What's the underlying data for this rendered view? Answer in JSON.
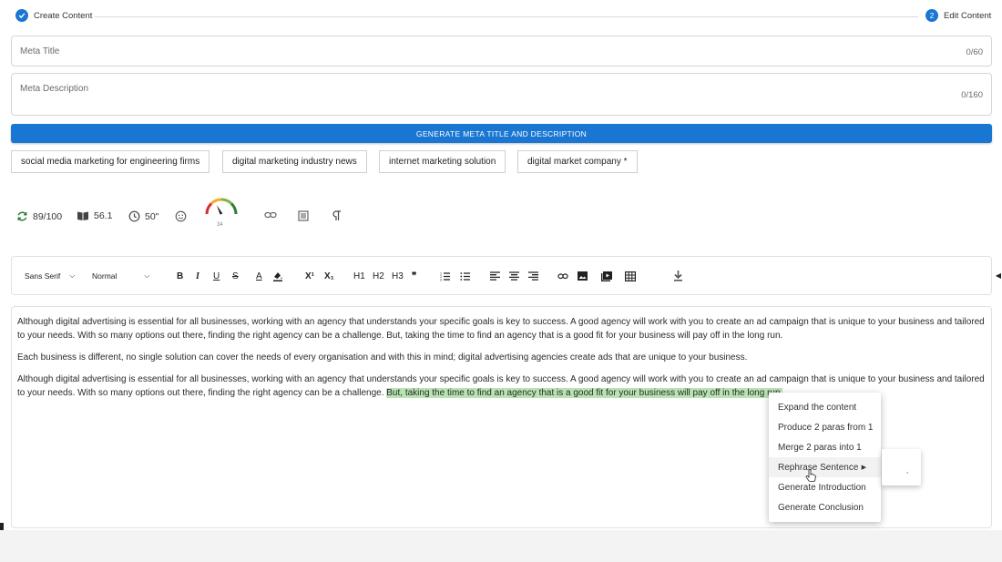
{
  "stepper": {
    "step1_label": "Create Content",
    "step2_number": "2",
    "step2_label": "Edit Content"
  },
  "meta_title": {
    "label": "Meta Title",
    "count": "0/60"
  },
  "meta_description": {
    "label": "Meta Description",
    "count": "0/160"
  },
  "generate_button": "GENERATE META TITLE AND DESCRIPTION",
  "keyword_chips": [
    "social media marketing for engineering firms",
    "digital marketing industry news",
    "internet marketing solution",
    "digital market company *"
  ],
  "metrics": {
    "score": "89/100",
    "readability": "56.1",
    "read_time": "50\"",
    "gauge_value": "34",
    "gauge_level": 0.34
  },
  "toolbar": {
    "font": "Sans Serif",
    "size": "Normal",
    "bold": "B",
    "italic": "I",
    "underline": "U",
    "strike": "S",
    "text_color": "A",
    "superscript": "X¹",
    "subscript": "X₁",
    "h1": "H1",
    "h2": "H2",
    "h3": "H3",
    "quote": "❞"
  },
  "editor": {
    "p1": "Although digital advertising is essential for all businesses, working with an agency that understands your specific goals is key to success. A good agency will work with you to create an ad campaign that is unique to your business and tailored to your needs. With so many options out there, finding the right agency can be a challenge. But, taking the time to find an agency that is a good fit for your business will pay off in the long run.",
    "p2": "Each business is different, no single solution can cover the needs of every organisation and with this in mind; digital advertising agencies create ads that are unique to your business.",
    "p3_plain": "Although digital advertising is essential for all businesses, working with an agency that understands your specific goals is key to success. A good agency will work with you to create an ad campaign that is unique to your business and tailored to your needs. With so many options out there, finding the right agency can be a challenge. ",
    "p3_highlight": "But, taking the time to find an agency that is a good fit for your business will pay off in the long run."
  },
  "context_menu": [
    "Expand the content",
    "Produce 2 paras from 1",
    "Merge 2 paras into 1",
    "Rephrase Sentence",
    "Generate Introduction",
    "Generate Conclusion"
  ],
  "submenu_mark": ",",
  "colors": {
    "primary": "#1976d2",
    "highlight": "#b9e3b3"
  }
}
